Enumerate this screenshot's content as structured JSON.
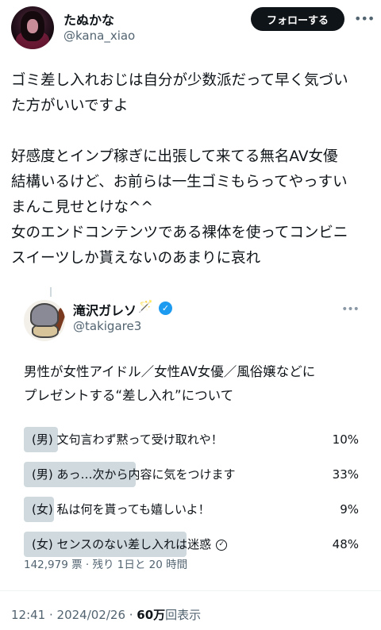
{
  "author": {
    "display_name": "たぬかな",
    "handle": "@kana_xiao",
    "follow_label": "フォローする",
    "more_icon": "more-horizontal-icon"
  },
  "tweet": {
    "lines": [
      "ゴミ差し入れおじは自分が少数派だって早く気づい",
      "た方がいいですよ",
      "",
      "好感度とインプ稼ぎに出張して来てる無名AV女優",
      "結構いるけど、お前らは一生ゴミもらってやっすい",
      "まんこ見せとけな^^",
      "女のエンドコンテンツである裸体を使ってコンビニ",
      "スイーツしか貰えないのあまりに哀れ"
    ]
  },
  "quote": {
    "display_name": "滝沢ガレソ",
    "name_decoration": "🪄",
    "verified_icon": "verified-badge-icon",
    "handle": "@takigare3",
    "text_lines": [
      "男性が女性アイドル／女性AV女優／風俗嬢などに",
      "プレゼントする“差し入れ”について"
    ],
    "poll": {
      "options": [
        {
          "label": "(男) 文句言わず黙って受け取れや！",
          "percent": "10%",
          "share": 0.1,
          "selected": false
        },
        {
          "label": "(男) あっ…次から内容に気をつけます",
          "percent": "33%",
          "share": 0.33,
          "selected": false
        },
        {
          "label": "(女) 私は何を貰っても嬉しいよ！",
          "percent": "9%",
          "share": 0.09,
          "selected": false
        },
        {
          "label": "(女) センスのない差し入れは迷惑",
          "percent": "48%",
          "share": 0.48,
          "selected": true
        }
      ],
      "meta": "142,979 票 · 残り 1日と 20 時間"
    }
  },
  "footer": {
    "time_date": "12:41 · 2024/02/26 · ",
    "views_value": "60万",
    "views_label": "回表示"
  },
  "colors": {
    "text": "#0f1419",
    "secondary": "#536471",
    "poll_bar": "#cfd9de",
    "verified": "#1d9bf0",
    "button_bg": "#0f1419"
  }
}
